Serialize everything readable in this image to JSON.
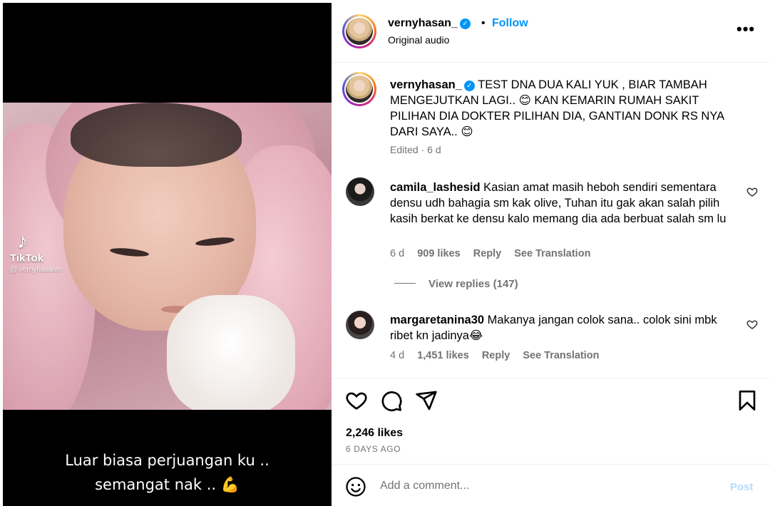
{
  "media": {
    "watermark_brand": "TikTok",
    "watermark_user": "@ vernyhasanm",
    "overlay_line1": "Luar biasa perjuangan ku ..",
    "overlay_line2": "semangat nak .. 💪"
  },
  "header": {
    "username": "vernyhasan_",
    "verified": "✓",
    "dot": "•",
    "follow_label": "Follow",
    "audio": "Original audio",
    "more_icon": "more-horizontal-icon"
  },
  "caption": {
    "username": "vernyhasan_",
    "text": " TEST DNA DUA KALI YUK , BIAR TAMBAH MENGEJUTKAN LAGI.. 😊 KAN KEMARIN RUMAH SAKIT PILIHAN DIA DOKTER PILIHAN DIA, GANTIAN DONK RS NYA DARI SAYA.. 😊",
    "meta": "Edited · 6 d"
  },
  "comments": [
    {
      "username": "camila_lashesid",
      "text": " Kasian amat masih heboh sendiri sementara densu udh bahagia sm kak olive, Tuhan itu gak akan salah pilih kasih berkat ke densu kalo memang dia ada berbuat salah sm lu",
      "age": "6 d",
      "likes": "909 likes",
      "reply": "Reply",
      "translate": "See Translation",
      "view_replies": "View replies (147)"
    },
    {
      "username": "margaretanina30",
      "text": " Makanya jangan colok sana.. colok sini mbk ribet kn jadinya😂",
      "age": "4 d",
      "likes": "1,451 likes",
      "reply": "Reply",
      "translate": "See Translation"
    }
  ],
  "actions": {
    "likes": "2,246 likes",
    "date": "6 DAYS AGO"
  },
  "add_comment": {
    "placeholder": "Add a comment...",
    "post_label": "Post"
  },
  "colors": {
    "link_blue": "#0095f6",
    "muted": "#737373",
    "post_disabled": "#b3dbff"
  }
}
